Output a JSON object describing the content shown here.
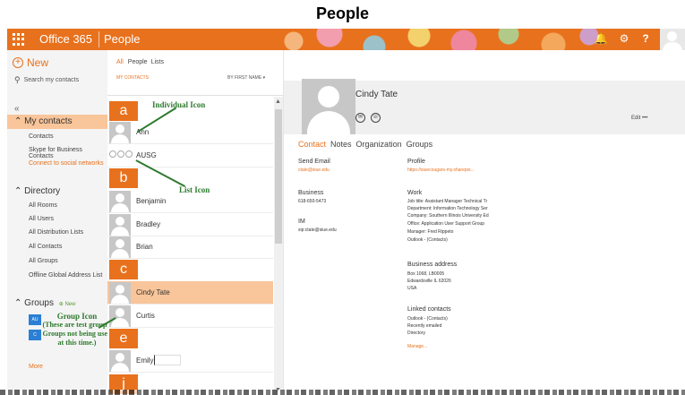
{
  "page_heading": "People",
  "topbar": {
    "brand": "Office 365",
    "app_title": "People",
    "icons": [
      "waffle-icon",
      "notification-icon",
      "gear-icon",
      "help-icon"
    ],
    "help_label": "?",
    "accent": "#e8711d"
  },
  "leftnav": {
    "new_label": "New",
    "search_placeholder": "Search my contacts",
    "collapse_label": "«",
    "my_contacts": {
      "title": "My contacts",
      "items": [
        "Contacts",
        "Skype for Business Contacts",
        "Connect to social networks"
      ]
    },
    "directory": {
      "title": "Directory",
      "items": [
        "All Rooms",
        "All Users",
        "All Distribution Lists",
        "All Contacts",
        "All Groups",
        "Offline Global Address List"
      ]
    },
    "groups": {
      "title": "Groups",
      "new_tag": "New",
      "tiles": [
        "AU",
        "C"
      ]
    },
    "more_label": "More"
  },
  "callouts": {
    "individual_icon": "Individual Icon",
    "list_icon": "List Icon",
    "group_icon": "Group Icon",
    "group_note": "(These are test groups. Groups not being used at this time.)"
  },
  "list": {
    "filters": {
      "all": "All",
      "people": "People",
      "lists": "Lists"
    },
    "folder_label": "MY CONTACTS",
    "sort_label": "BY FIRST NAME",
    "letters": [
      "a",
      "b",
      "c",
      "e",
      "j"
    ],
    "contacts": [
      "Ann",
      "AUSG",
      "Benjamin",
      "Bradley",
      "Brian",
      "Cindy Tate",
      "Curtis",
      "Emily"
    ],
    "scroll_up": "▲",
    "scroll_down": "▼"
  },
  "detail": {
    "name": "Cindy Tate",
    "edit_label": "Edit",
    "more_label": "•••",
    "tabs": [
      "Contact",
      "Notes",
      "Organization",
      "Groups"
    ],
    "send_email_label": "Send Email",
    "send_email_value": "ctate@siue.edu",
    "profile_label": "Profile",
    "profile_value": "https://siuecougars-my.sharepoi...",
    "business_label": "Business",
    "business_value": "618-650-5473",
    "work_label": "Work",
    "work_lines": [
      "Job title:  Assistant Manager Technical Tr",
      "Department:  Information Technology Ser",
      "Company:  Southern Illinois University Ed",
      "Office:  Application User Support Group",
      "Manager:  Fred Rippeto",
      "Outlook - (Contacts)"
    ],
    "im_label": "IM",
    "im_value": "sip:ctate@siue.edu",
    "address_label": "Business address",
    "address_lines": [
      "Box 1068, LB0005",
      "Edwardsville IL 62026",
      "USA"
    ],
    "linked_label": "Linked contacts",
    "linked_lines": [
      "Outlook - (Contacts)",
      "Recently emailed",
      "Directory"
    ],
    "manage_label": "Manage..."
  }
}
